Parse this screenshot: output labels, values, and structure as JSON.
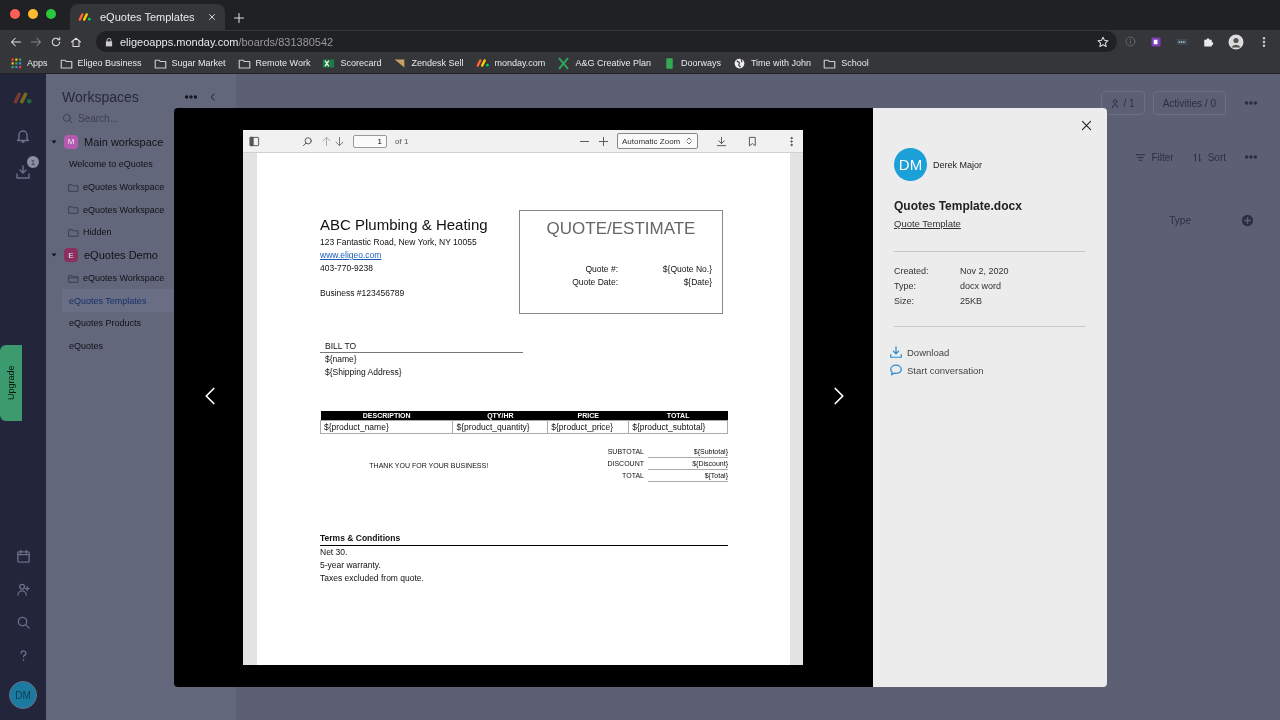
{
  "browser": {
    "tab_title": "eQuotes Templates",
    "url_host": "eligeoapps.monday.com",
    "url_path": "/boards/831380542",
    "bookmarks": [
      {
        "label": "Apps",
        "kind": "apps"
      },
      {
        "label": "Eligeo Business",
        "kind": "folder"
      },
      {
        "label": "Sugar Market",
        "kind": "folder"
      },
      {
        "label": "Remote Work",
        "kind": "folder"
      },
      {
        "label": "Scorecard",
        "kind": "sheet"
      },
      {
        "label": "Zendesk Sell",
        "kind": "zendesk"
      },
      {
        "label": "monday.com",
        "kind": "monday"
      },
      {
        "label": "A&G Creative Plan",
        "kind": "excel"
      },
      {
        "label": "Doorways",
        "kind": "doc"
      },
      {
        "label": "Time with John",
        "kind": "globe"
      },
      {
        "label": "School",
        "kind": "folder"
      }
    ]
  },
  "rail": {
    "download_badge": "1",
    "upgrade": "Upgrade",
    "avatar": "DM"
  },
  "sidebar": {
    "title": "Workspaces",
    "search": {
      "placeholder": "Search..."
    },
    "workspaces": [
      {
        "name": "Main workspace",
        "letter": "M",
        "color": "#b45ab0",
        "expanded": true,
        "items": [
          {
            "label": "Welcome to eQuotes",
            "kind": "board",
            "selected": false
          },
          {
            "label": "eQuotes Workspace",
            "kind": "folder",
            "selected": false
          },
          {
            "label": "eQuotes Workspace",
            "kind": "folder",
            "selected": false
          },
          {
            "label": "Hidden",
            "kind": "folder",
            "selected": false
          }
        ]
      },
      {
        "name": "eQuotes Demo",
        "letter": "E",
        "color": "#8a2f60",
        "expanded": true,
        "items": [
          {
            "label": "eQuotes Workspace",
            "kind": "open-folder",
            "selected": false
          },
          {
            "label": "eQuotes Templates",
            "kind": "board",
            "selected": true
          },
          {
            "label": "eQuotes Products",
            "kind": "board",
            "selected": false
          },
          {
            "label": "eQuotes",
            "kind": "board",
            "selected": false
          }
        ]
      }
    ]
  },
  "board": {
    "members": "/ 1",
    "activities": "Activities / 0",
    "filter": "Filter",
    "sort": "Sort",
    "column": "Type"
  },
  "viewer": {
    "toolbar": {
      "page": "1",
      "of": "of 1",
      "zoom": "Automatic Zoom"
    },
    "document": {
      "company": "ABC Plumbing & Heating",
      "address": "123 Fantastic Road, New York, NY 10055",
      "website": "www.eligeo.com",
      "phone": "403-770-9238",
      "business": "Business #123456789",
      "quote": {
        "title": "QUOTE/ESTIMATE",
        "fields": [
          {
            "label": "Quote #:",
            "value": "${Quote No.}"
          },
          {
            "label": "Quote Date:",
            "value": "${Date}"
          }
        ]
      },
      "bill_to": {
        "heading": "BILL TO",
        "lines": [
          "${name}",
          "${Shipping Address}"
        ]
      },
      "table": {
        "columns": [
          "DESCRIPTION",
          "QTY/HR",
          "PRICE",
          "TOTAL"
        ],
        "rows": [
          [
            "${product_name}",
            "${product_quantity}",
            "${product_price}",
            "${product_subtotal}"
          ]
        ]
      },
      "thanks": "THANK YOU FOR YOUR BUSINESS!",
      "totals": [
        {
          "label": "SUBTOTAL",
          "value": "${Subtotal}"
        },
        {
          "label": "DISCOUNT",
          "value": "${Discount}"
        },
        {
          "label": "TOTAL",
          "value": "${Total}"
        }
      ],
      "terms": {
        "heading": "Terms & Conditions",
        "lines": [
          "Net 30.",
          "5-year warranty.",
          "Taxes excluded from quote."
        ]
      }
    }
  },
  "details": {
    "initials": "DM",
    "user": "Derek Major",
    "file_name": "Quotes Template.docx",
    "link": "Quote Template",
    "meta": [
      {
        "label": "Created:",
        "value": "Nov 2, 2020"
      },
      {
        "label": "Type:",
        "value": "docx word"
      },
      {
        "label": "Size:",
        "value": "25KB"
      }
    ],
    "actions": [
      {
        "label": "Download",
        "kind": "download"
      },
      {
        "label": "Start conversation",
        "kind": "chat"
      }
    ]
  }
}
